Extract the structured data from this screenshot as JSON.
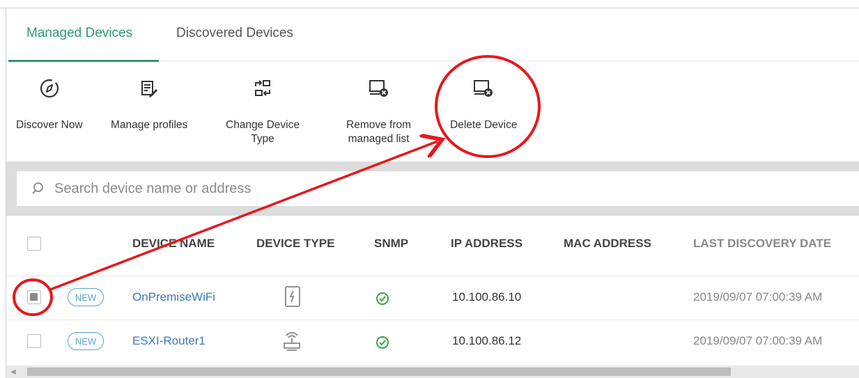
{
  "tabs": [
    {
      "label": "Managed Devices",
      "active": true
    },
    {
      "label": "Discovered Devices",
      "active": false
    }
  ],
  "toolbar": {
    "discover_now": "Discover Now",
    "manage_profiles": "Manage profiles",
    "change_device_type_1": "Change Device",
    "change_device_type_2": "Type",
    "remove_managed_1": "Remove from",
    "remove_managed_2": "managed list",
    "delete_device": "Delete Device"
  },
  "search": {
    "placeholder": "Search device name or address"
  },
  "table": {
    "columns": [
      "DEVICE NAME",
      "DEVICE TYPE",
      "SNMP",
      "IP ADDRESS",
      "MAC ADDRESS",
      "LAST DISCOVERY DATE"
    ],
    "rows": [
      {
        "checked": true,
        "badge": "NEW",
        "name": "OnPremiseWiFi",
        "type_icon": "wifi-device-icon",
        "snmp_icon": "check-circle-icon",
        "ip": "10.100.86.10",
        "mac": "",
        "last_discovery": "2019/09/07 07:00:39 AM"
      },
      {
        "checked": false,
        "badge": "NEW",
        "name": "ESXI-Router1",
        "type_icon": "router-icon",
        "snmp_icon": "check-circle-icon",
        "ip": "10.100.86.12",
        "mac": "",
        "last_discovery": "2019/09/07 07:00:39 AM"
      }
    ]
  },
  "colors": {
    "accent": "#2e9a6f",
    "link": "#3d78b8",
    "badge": "#5ba3d0",
    "annotation": "#e8161c",
    "snmp_ok": "#3aa24a"
  }
}
